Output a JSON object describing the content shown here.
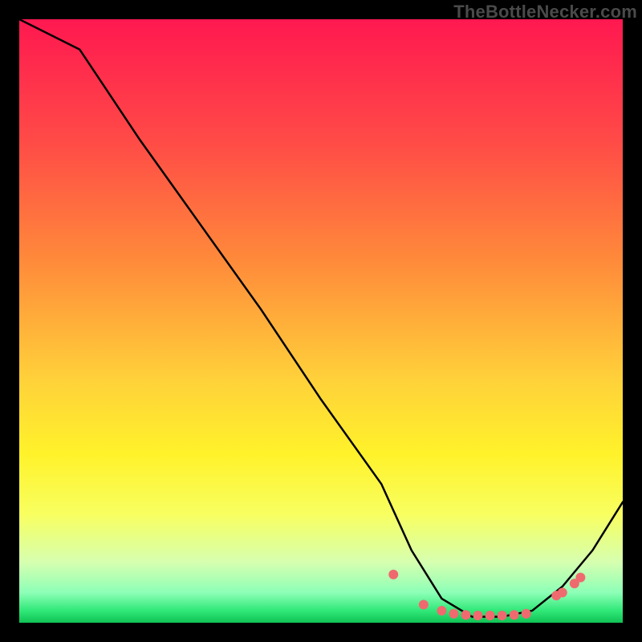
{
  "watermark": "TheBottleNecker.com",
  "chart_data": {
    "type": "line",
    "title": "",
    "xlabel": "",
    "ylabel": "",
    "xlim": [
      0,
      100
    ],
    "ylim": [
      0,
      100
    ],
    "grid": false,
    "legend": false,
    "series": [
      {
        "name": "curve",
        "stroke": "#000000",
        "x": [
          0,
          10,
          20,
          30,
          40,
          50,
          60,
          65,
          70,
          75,
          80,
          85,
          90,
          95,
          100
        ],
        "y": [
          100,
          95,
          80,
          66,
          52,
          37,
          23,
          12,
          4,
          1,
          1,
          2,
          6,
          12,
          20
        ]
      }
    ],
    "markers": {
      "name": "dots",
      "color": "#ef6a6f",
      "radius": 6,
      "x": [
        62,
        67,
        70,
        72,
        74,
        76,
        78,
        80,
        82,
        84,
        89,
        90,
        92,
        93
      ],
      "y": [
        8,
        3,
        2,
        1.5,
        1.3,
        1.2,
        1.2,
        1.2,
        1.3,
        1.5,
        4.5,
        5,
        6.5,
        7.5
      ]
    },
    "background_gradient": {
      "stops": [
        {
          "offset": 0.0,
          "color": "#ff1850"
        },
        {
          "offset": 0.2,
          "color": "#ff4a47"
        },
        {
          "offset": 0.4,
          "color": "#ff8a3a"
        },
        {
          "offset": 0.6,
          "color": "#ffd23a"
        },
        {
          "offset": 0.72,
          "color": "#fff22a"
        },
        {
          "offset": 0.82,
          "color": "#f8ff60"
        },
        {
          "offset": 0.9,
          "color": "#d6ffb0"
        },
        {
          "offset": 0.95,
          "color": "#8dffb7"
        },
        {
          "offset": 0.98,
          "color": "#30e878"
        },
        {
          "offset": 1.0,
          "color": "#0fc254"
        }
      ]
    }
  }
}
